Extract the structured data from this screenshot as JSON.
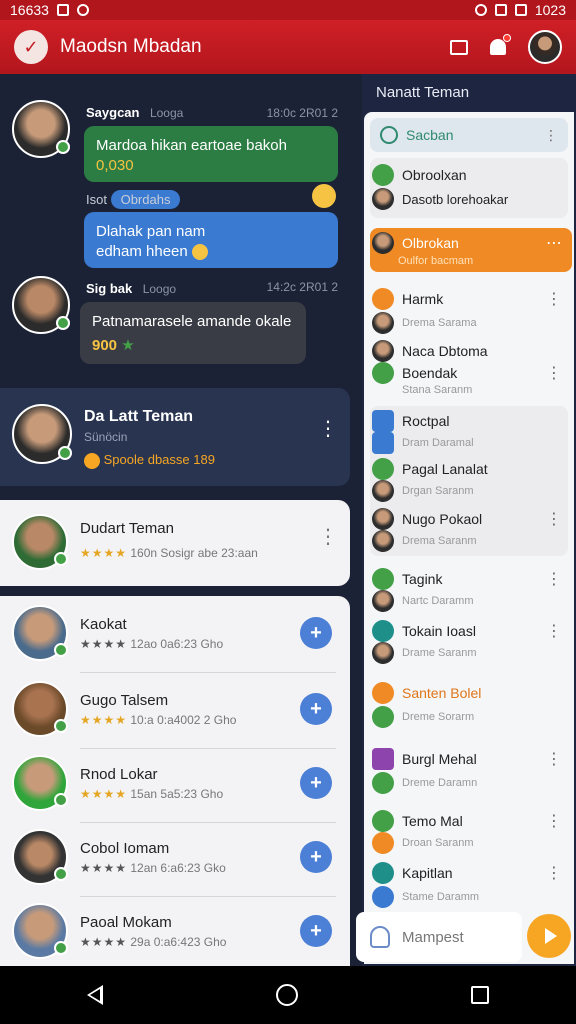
{
  "statusbar": {
    "time_left": "16633",
    "time_right": "1023"
  },
  "appbar": {
    "title": "Maodsn Mbadan"
  },
  "chat": {
    "msg1": {
      "name": "Saygcan",
      "badge": "Looga",
      "time": "18:0c 2R01 2",
      "text1": "Mardoa hikan eartoae bakoh",
      "text2": "0,030",
      "sub_label": "Isot",
      "pill": "Obrdahs",
      "text3": "Dlahak pan nam",
      "text4": "edham hheen"
    },
    "msg2": {
      "name": "Sig bak",
      "badge": "Loogo",
      "time": "14:2c 2R01 2",
      "text": "Patnamarasele amande okale",
      "score": "900"
    }
  },
  "highlight_card": {
    "name": "Da Latt Teman",
    "sub": "Sünöcin",
    "meta": "Spoole dbasse 189"
  },
  "top_friend": {
    "name": "Dudart Teman",
    "meta": "160n Sosigr abe 23:aan"
  },
  "friends": [
    {
      "name": "Kaokat",
      "meta": "12ao 0a6:23 Gho"
    },
    {
      "name": "Gugo Talsem",
      "meta": "10:a 0:a4002 2 Gho"
    },
    {
      "name": "Rnod Lokar",
      "meta": "15an 5a5:23 Gho"
    },
    {
      "name": "Cobol Iomam",
      "meta": "12an 6:a6:23 Gko"
    },
    {
      "name": "Paoal Mokam",
      "meta": "29a 0:a6:423 Gho"
    }
  ],
  "right_panel": {
    "title": "Nanatt Teman",
    "search": "Sacban",
    "rows": [
      {
        "label": "Obroolxan",
        "sub": "Dasotb lorehoakar"
      },
      {
        "label": "Olbrokan",
        "sub": "Oulfor bacmam"
      },
      {
        "label": "Harmk",
        "sub": "Drema Sarama"
      },
      {
        "label": "Naca Dbtoma",
        "sub": "Boendak"
      },
      {
        "label": "Stana Saranm",
        "sub": ""
      },
      {
        "label": "Roctpal",
        "sub": "Dram Daramal"
      },
      {
        "label": "Pagal Lanalat",
        "sub": "Drgan Saranm"
      },
      {
        "label": "Nugo Pokaol",
        "sub": "Drema Saranm"
      },
      {
        "label": "Tagink",
        "sub": "Nartc Daramm"
      },
      {
        "label": "Tokain Ioasl",
        "sub": "Drame Saranm"
      },
      {
        "label": "Santen Bolel",
        "sub": "Dreme Sorarm"
      },
      {
        "label": "Burgl Mehal",
        "sub": "Dreme Daramn"
      },
      {
        "label": "Temo Mal",
        "sub": "Droan Saranm"
      },
      {
        "label": "Kapitlan",
        "sub": "Stame Daramm"
      }
    ]
  },
  "composer": {
    "placeholder": "Mampest"
  }
}
